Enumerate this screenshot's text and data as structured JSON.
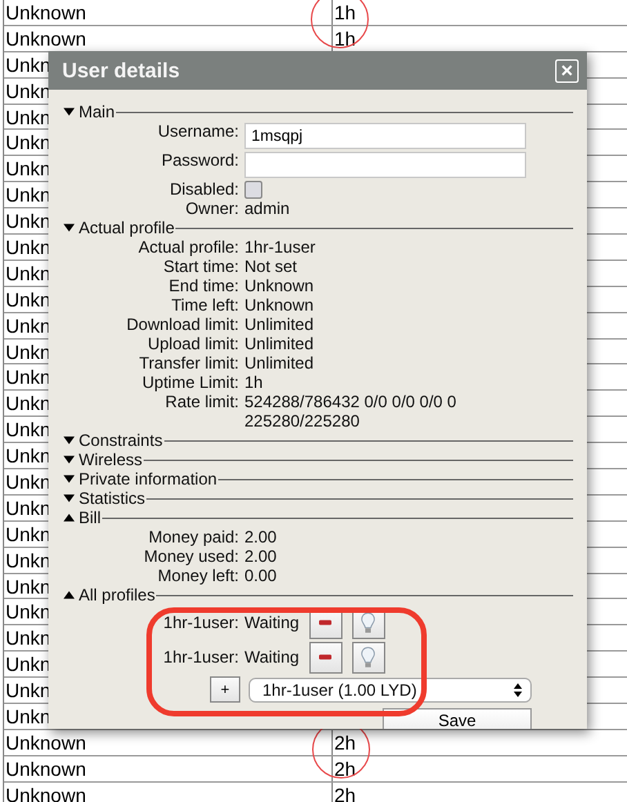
{
  "table": {
    "rows": [
      {
        "column_1": "Unknown",
        "column_2": "1h"
      },
      {
        "column_1": "Unknown",
        "column_2": "1h"
      },
      {
        "column_1": "Unkn"
      },
      {
        "column_1": "Unkn"
      },
      {
        "column_1": "Unkn"
      },
      {
        "column_1": "Unkn"
      },
      {
        "column_1": "Unkn"
      },
      {
        "column_1": "Unkn"
      },
      {
        "column_1": "Unkn"
      },
      {
        "column_1": "Unkn"
      },
      {
        "column_1": "Unkn"
      },
      {
        "column_1": "Unkn"
      },
      {
        "column_1": "Unkn"
      },
      {
        "column_1": "Unkn"
      },
      {
        "column_1": "Unkn"
      },
      {
        "column_1": "Unkn"
      },
      {
        "column_1": "Unkn"
      },
      {
        "column_1": "Unkn"
      },
      {
        "column_1": "Unkn"
      },
      {
        "column_1": "Unkn"
      },
      {
        "column_1": "Unkn"
      },
      {
        "column_1": "Unkn"
      },
      {
        "column_1": "Unkn"
      },
      {
        "column_1": "Unkn"
      },
      {
        "column_1": "Unkn"
      },
      {
        "column_1": "Unkn"
      },
      {
        "column_1": "Unkn"
      },
      {
        "column_1": "Unkn"
      },
      {
        "column_1": "Unknown",
        "column_2": "2h"
      },
      {
        "column_1": "Unknown",
        "column_2": "2h"
      },
      {
        "column_1": "Unknown",
        "column_2": "2h"
      }
    ]
  },
  "dialog": {
    "title": "User details",
    "close": "×",
    "sections": [
      {
        "title": "Main",
        "arrow_up": false,
        "kind": "fields",
        "fields": [
          {
            "kind": "input",
            "label": "Username:",
            "value": "1msqpj"
          },
          {
            "kind": "input",
            "label": "Password:"
          },
          {
            "kind": "checkbox",
            "label": "Disabled:",
            "checked": false
          },
          {
            "kind": "text",
            "label": "Owner:",
            "value": "admin"
          }
        ]
      },
      {
        "title": "Actual profile",
        "arrow_up": false,
        "kind": "fields",
        "fields": [
          {
            "kind": "text",
            "label": "Actual profile:",
            "value": "1hr-1user"
          },
          {
            "kind": "text",
            "label": "Start time:",
            "value": "Not set"
          },
          {
            "kind": "text",
            "label": "End time:",
            "value": "Unknown"
          },
          {
            "kind": "text",
            "label": "Time left:",
            "value": "Unknown"
          },
          {
            "kind": "text",
            "label": "Download limit:",
            "value": "Unlimited"
          },
          {
            "kind": "text",
            "label": "Upload limit:",
            "value": "Unlimited"
          },
          {
            "kind": "text",
            "label": "Transfer limit:",
            "value": "Unlimited"
          },
          {
            "kind": "text",
            "label": "Uptime Limit:",
            "value": "1h"
          },
          {
            "kind": "text",
            "label": "Rate limit:",
            "value": "524288/786432 0/0 0/0 0/0 0 225280/225280"
          }
        ]
      },
      {
        "title": "Constraints",
        "arrow_up": false,
        "kind": "none"
      },
      {
        "title": "Wireless",
        "arrow_up": false,
        "kind": "none"
      },
      {
        "title": "Private information",
        "arrow_up": false,
        "kind": "none"
      },
      {
        "title": "Statistics",
        "arrow_up": false,
        "kind": "none"
      },
      {
        "title": "Bill",
        "arrow_up": true,
        "kind": "fields",
        "fields": [
          {
            "kind": "text",
            "label": "Money paid:",
            "value": "2.00"
          },
          {
            "kind": "text",
            "label": "Money used:",
            "value": "2.00"
          },
          {
            "kind": "text",
            "label": "Money left:",
            "value": "0.00"
          }
        ]
      },
      {
        "title": "All profiles",
        "arrow_up": true,
        "kind": "profiles",
        "profiles": [
          {
            "name": "1hr-1user:",
            "status": "Waiting"
          },
          {
            "name": "1hr-1user:",
            "status": "Waiting"
          }
        ],
        "add_button": "+",
        "select": "1hr-1user (1.00 LYD)"
      }
    ],
    "save_button": "Save"
  }
}
